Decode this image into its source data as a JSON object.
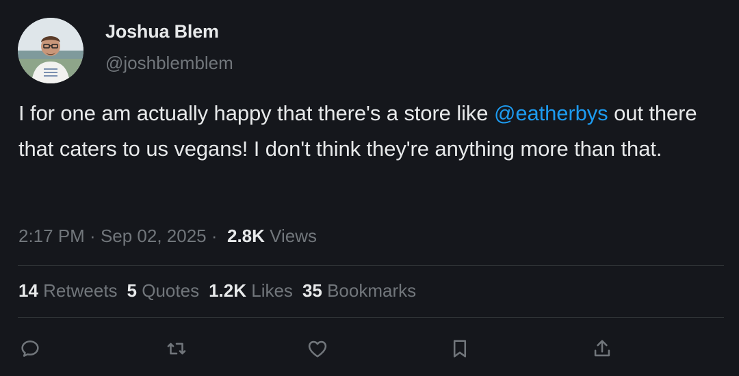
{
  "author": {
    "name": "Joshua Blem",
    "handle": "@joshblemblem"
  },
  "tweet": {
    "text_before": "I for one am actually happy that there's a store like ",
    "mention": "@eatherbys",
    "text_after": " out there that caters to us vegans! I don't think they're anything more than that."
  },
  "meta": {
    "time": "2:17 PM",
    "sep1": " · ",
    "date": "Sep 02, 2025",
    "sep2": " · ",
    "views_count": "2.8K",
    "views_label": "Views"
  },
  "stats": {
    "retweets_count": "14",
    "retweets_label": "Retweets",
    "quotes_count": "5",
    "quotes_label": "Quotes",
    "likes_count": "1.2K",
    "likes_label": "Likes",
    "bookmarks_count": "35",
    "bookmarks_label": "Bookmarks"
  },
  "actions": [
    "reply-icon",
    "retweet-icon",
    "like-icon",
    "bookmark-icon",
    "share-icon"
  ],
  "colors": {
    "background": "#15171c",
    "text": "#e7e9ea",
    "muted": "#71767b",
    "accent": "#1d9bf0",
    "divider": "#2f3336"
  }
}
